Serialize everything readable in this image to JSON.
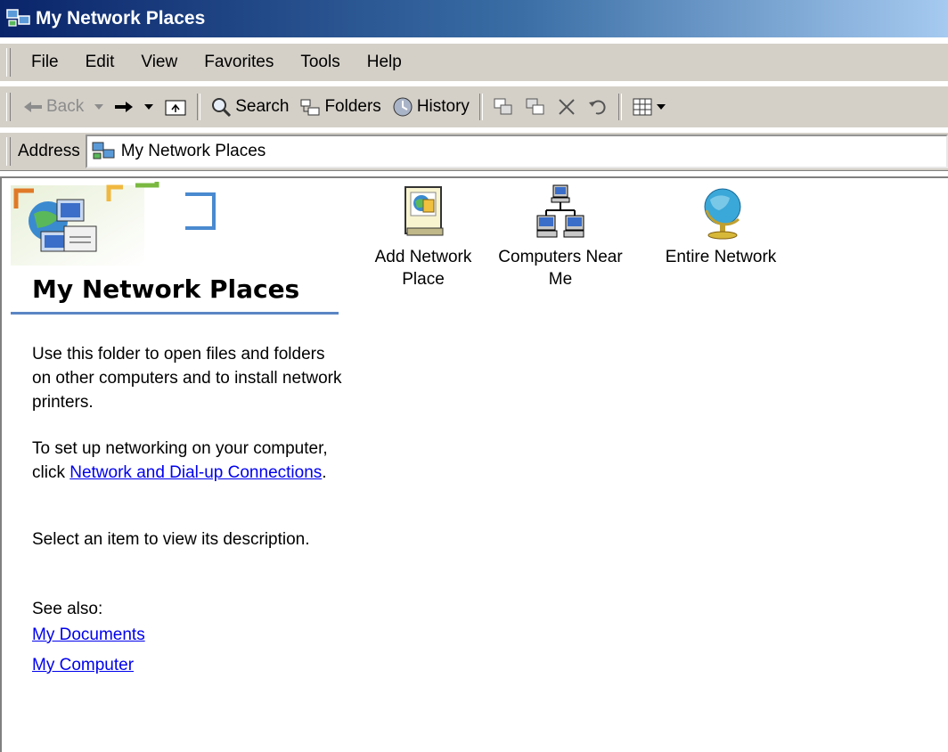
{
  "window": {
    "title": "My Network Places"
  },
  "menubar": {
    "items": [
      "File",
      "Edit",
      "View",
      "Favorites",
      "Tools",
      "Help"
    ]
  },
  "toolbar": {
    "back": "Back",
    "search": "Search",
    "folders": "Folders",
    "history": "History"
  },
  "address": {
    "label": "Address",
    "value": "My Network Places"
  },
  "left_pane": {
    "title": "My Network Places",
    "description": "Use this folder to open files and folders on other computers and to install network printers.",
    "setup_prefix": "To set up networking on your computer, click ",
    "setup_link": "Network and Dial-up Connections",
    "setup_suffix": ".",
    "select_hint": "Select an item to view its description.",
    "see_also": "See also:",
    "links": [
      "My Documents",
      "My Computer"
    ]
  },
  "items": [
    {
      "label": "Add Network Place",
      "icon": "add-network-place-icon"
    },
    {
      "label": "Computers Near Me",
      "icon": "computers-near-me-icon"
    },
    {
      "label": "Entire Network",
      "icon": "entire-network-icon"
    }
  ],
  "colors": {
    "title_start": "#0a246a",
    "title_end": "#a6caf0",
    "chrome": "#d4d0c8",
    "link": "#0000ee",
    "rule": "#5b85c4"
  }
}
